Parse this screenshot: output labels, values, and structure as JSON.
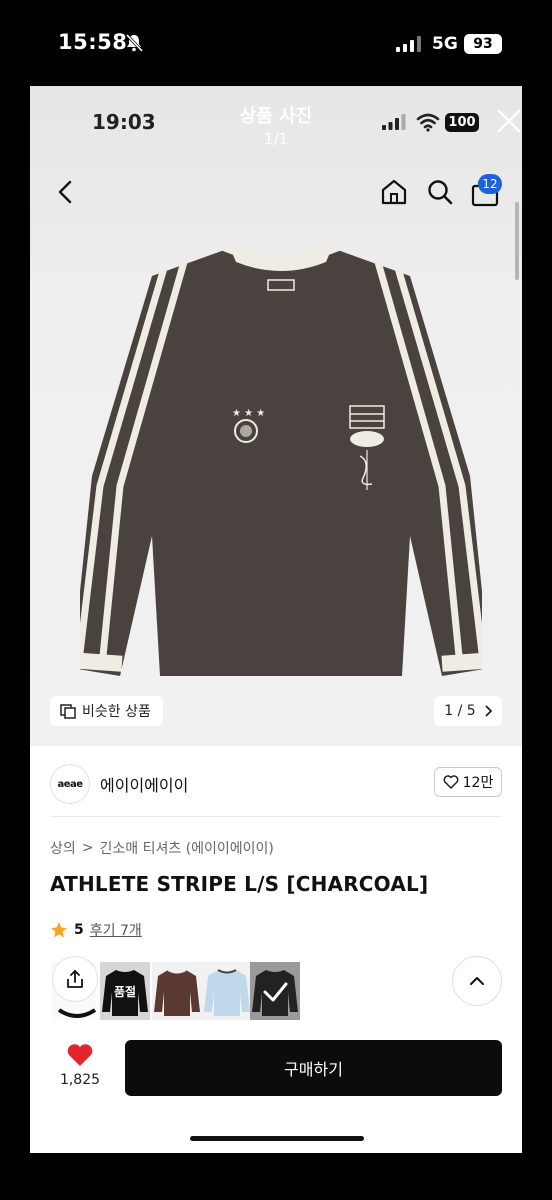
{
  "device_status": {
    "time": "15:58",
    "network": "5G",
    "battery": "93"
  },
  "inner_status": {
    "time": "19:03",
    "battery": "100"
  },
  "viewer": {
    "title": "상품 사진",
    "count": "1/1"
  },
  "nav": {
    "cart_count": "12"
  },
  "photo": {
    "similar_label": "비슷한 상품",
    "page_indicator": "1 / 5"
  },
  "brand": {
    "logo_text": "aeae",
    "name": "에이이에이이",
    "likes": "12만"
  },
  "breadcrumb": {
    "category": "상의",
    "separator": ">",
    "subcategory": "긴소매 티셔츠 (에이이에이이)"
  },
  "product": {
    "title": "ATHLETE STRIPE L/S [CHARCOAL]",
    "rating": "5",
    "reviews": "후기 7개"
  },
  "swatches": {
    "sold_out_label": "품절"
  },
  "bottom": {
    "wish_count": "1,825",
    "buy_label": "구매하기"
  },
  "colors": {
    "shirt_body": "#4a423f",
    "stripe": "#efece4",
    "badge_blue": "#1f63d8",
    "heart_red": "#e3262d",
    "star_orange": "#f5a623",
    "buy_button": "#0c0c0c"
  }
}
